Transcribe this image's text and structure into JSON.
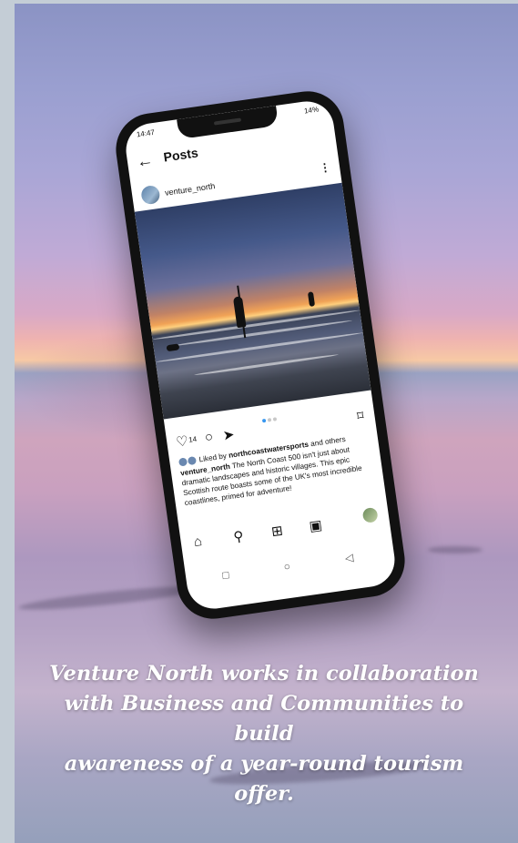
{
  "phone": {
    "status_time": "14:47",
    "status_right": "14%",
    "header_title": "Posts",
    "back_icon": "←",
    "account_name": "venture_north",
    "more_icon": "⋮",
    "likes_count": "14",
    "liked_prefix": "Liked by",
    "liked_user": "northcoastwatersports",
    "liked_suffix": "and others",
    "caption_user": "venture_north",
    "caption_text": "The North Coast 500 isn't just about dramatic landscapes and historic villages. This epic Scottish route boasts some of the UK's most incredible coastlines, primed for adventure!",
    "icons": {
      "like": "heart-icon",
      "comment": "comment-icon",
      "share": "send-icon",
      "save": "bookmark-icon",
      "home": "home-icon",
      "search": "search-icon",
      "create": "plus-icon",
      "reels": "reels-icon",
      "profile": "avatar-icon"
    }
  },
  "tagline": {
    "line1": "Venture North works in collaboration",
    "line2": "with Business and Communities to build",
    "line3": "awareness of a year-round tourism offer."
  }
}
